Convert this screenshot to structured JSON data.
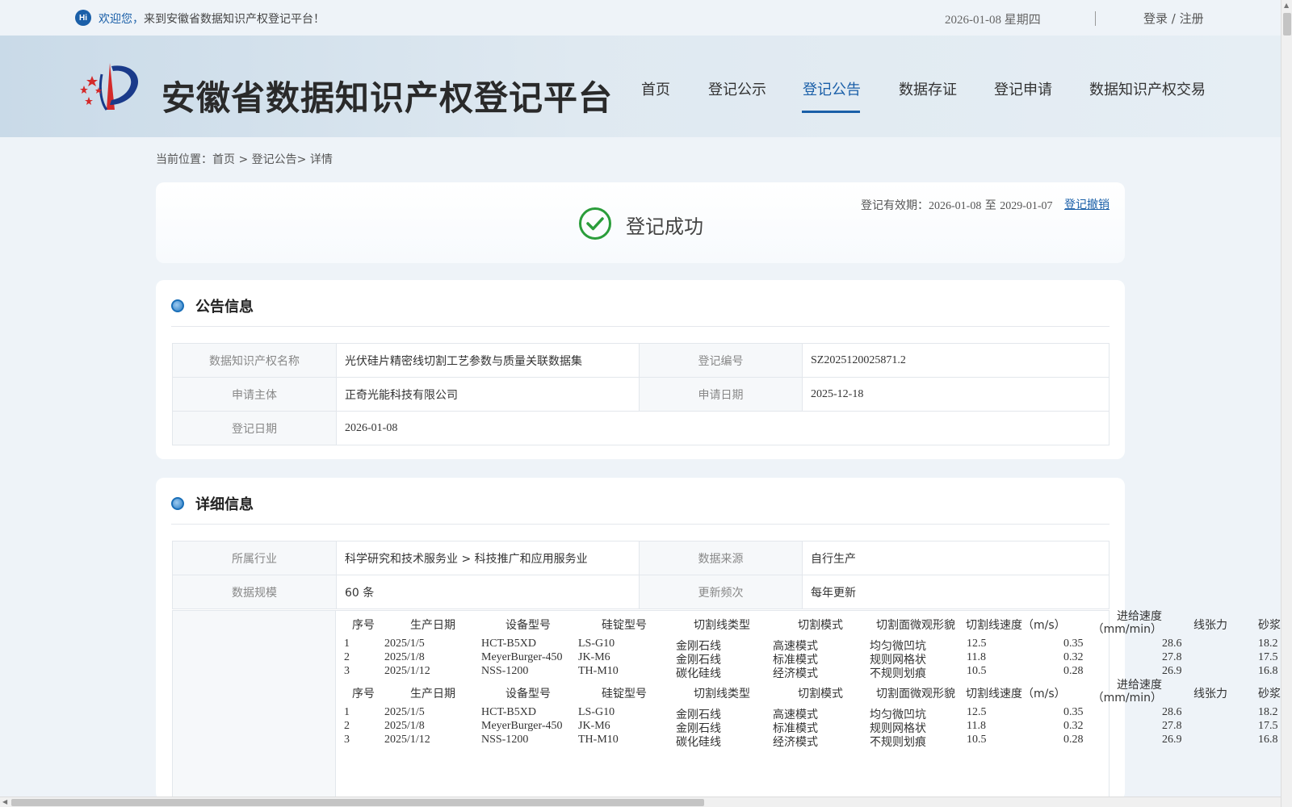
{
  "topbar": {
    "hi": "Hi",
    "welcome_bold": "欢迎您，",
    "welcome_rest": "来到安徽省数据知识产权登记平台！",
    "date": "2026-01-08 星期四",
    "login": "登录 / 注册"
  },
  "header": {
    "site_title": "安徽省数据知识产权登记平台",
    "nav": [
      "首页",
      "登记公示",
      "登记公告",
      "数据存证",
      "登记申请",
      "数据知识产权交易"
    ],
    "active_nav": "登记公告"
  },
  "breadcrumb": {
    "prefix": "当前位置：",
    "home": "首页",
    "sep1": " > ",
    "section": "登记公告",
    "sep2": "> ",
    "current": "详情"
  },
  "status": {
    "text": "登记成功",
    "validity_label": "登记有效期：",
    "validity_start": "2026-01-08",
    "validity_to": " 至 ",
    "validity_end": "2029-01-07",
    "revoke": "登记撤销"
  },
  "notice": {
    "title": "公告信息",
    "name_label": "数据知识产权名称",
    "name": "光伏硅片精密线切割工艺参数与质量关联数据集",
    "reg_no_label": "登记编号",
    "reg_no": "SZ2025120025871.2",
    "applicant_label": "申请主体",
    "applicant": "正奇光能科技有限公司",
    "apply_date_label": "申请日期",
    "apply_date": "2025-12-18",
    "reg_date_label": "登记日期",
    "reg_date": "2026-01-08"
  },
  "detail": {
    "title": "详细信息",
    "industry_label": "所属行业",
    "industry": "科学研究和技术服务业 > 科技推广和应用服务业",
    "source_label": "数据来源",
    "source": "自行生产",
    "scale_label": "数据规模",
    "scale": "60 条",
    "freq_label": "更新频次",
    "freq": "每年更新"
  },
  "sample_table": {
    "headers": [
      "序号",
      "生产日期",
      "设备型号",
      "硅锭型号",
      "切割线类型",
      "切割模式",
      "切割面微观形貌",
      "切割线速度（m/s）",
      "进给速度（mm/min）",
      "线张力",
      "砂浆"
    ],
    "rows": [
      [
        "1",
        "2025/1/5",
        "HCT-B5XD",
        "LS-G10",
        "金刚石线",
        "高速模式",
        "均匀微凹坑",
        "12.5",
        "0.35",
        "28.6",
        "18.2"
      ],
      [
        "2",
        "2025/1/8",
        "MeyerBurger-450",
        "JK-M6",
        "金刚石线",
        "标准模式",
        "规则网格状",
        "11.8",
        "0.32",
        "27.8",
        "17.5"
      ],
      [
        "3",
        "2025/1/12",
        "NSS-1200",
        "TH-M10",
        "碳化硅线",
        "经济模式",
        "不规则划痕",
        "10.5",
        "0.28",
        "26.9",
        "16.8"
      ]
    ]
  },
  "colors": {
    "accent": "#1a5fa8",
    "success": "#2a9d3a"
  }
}
